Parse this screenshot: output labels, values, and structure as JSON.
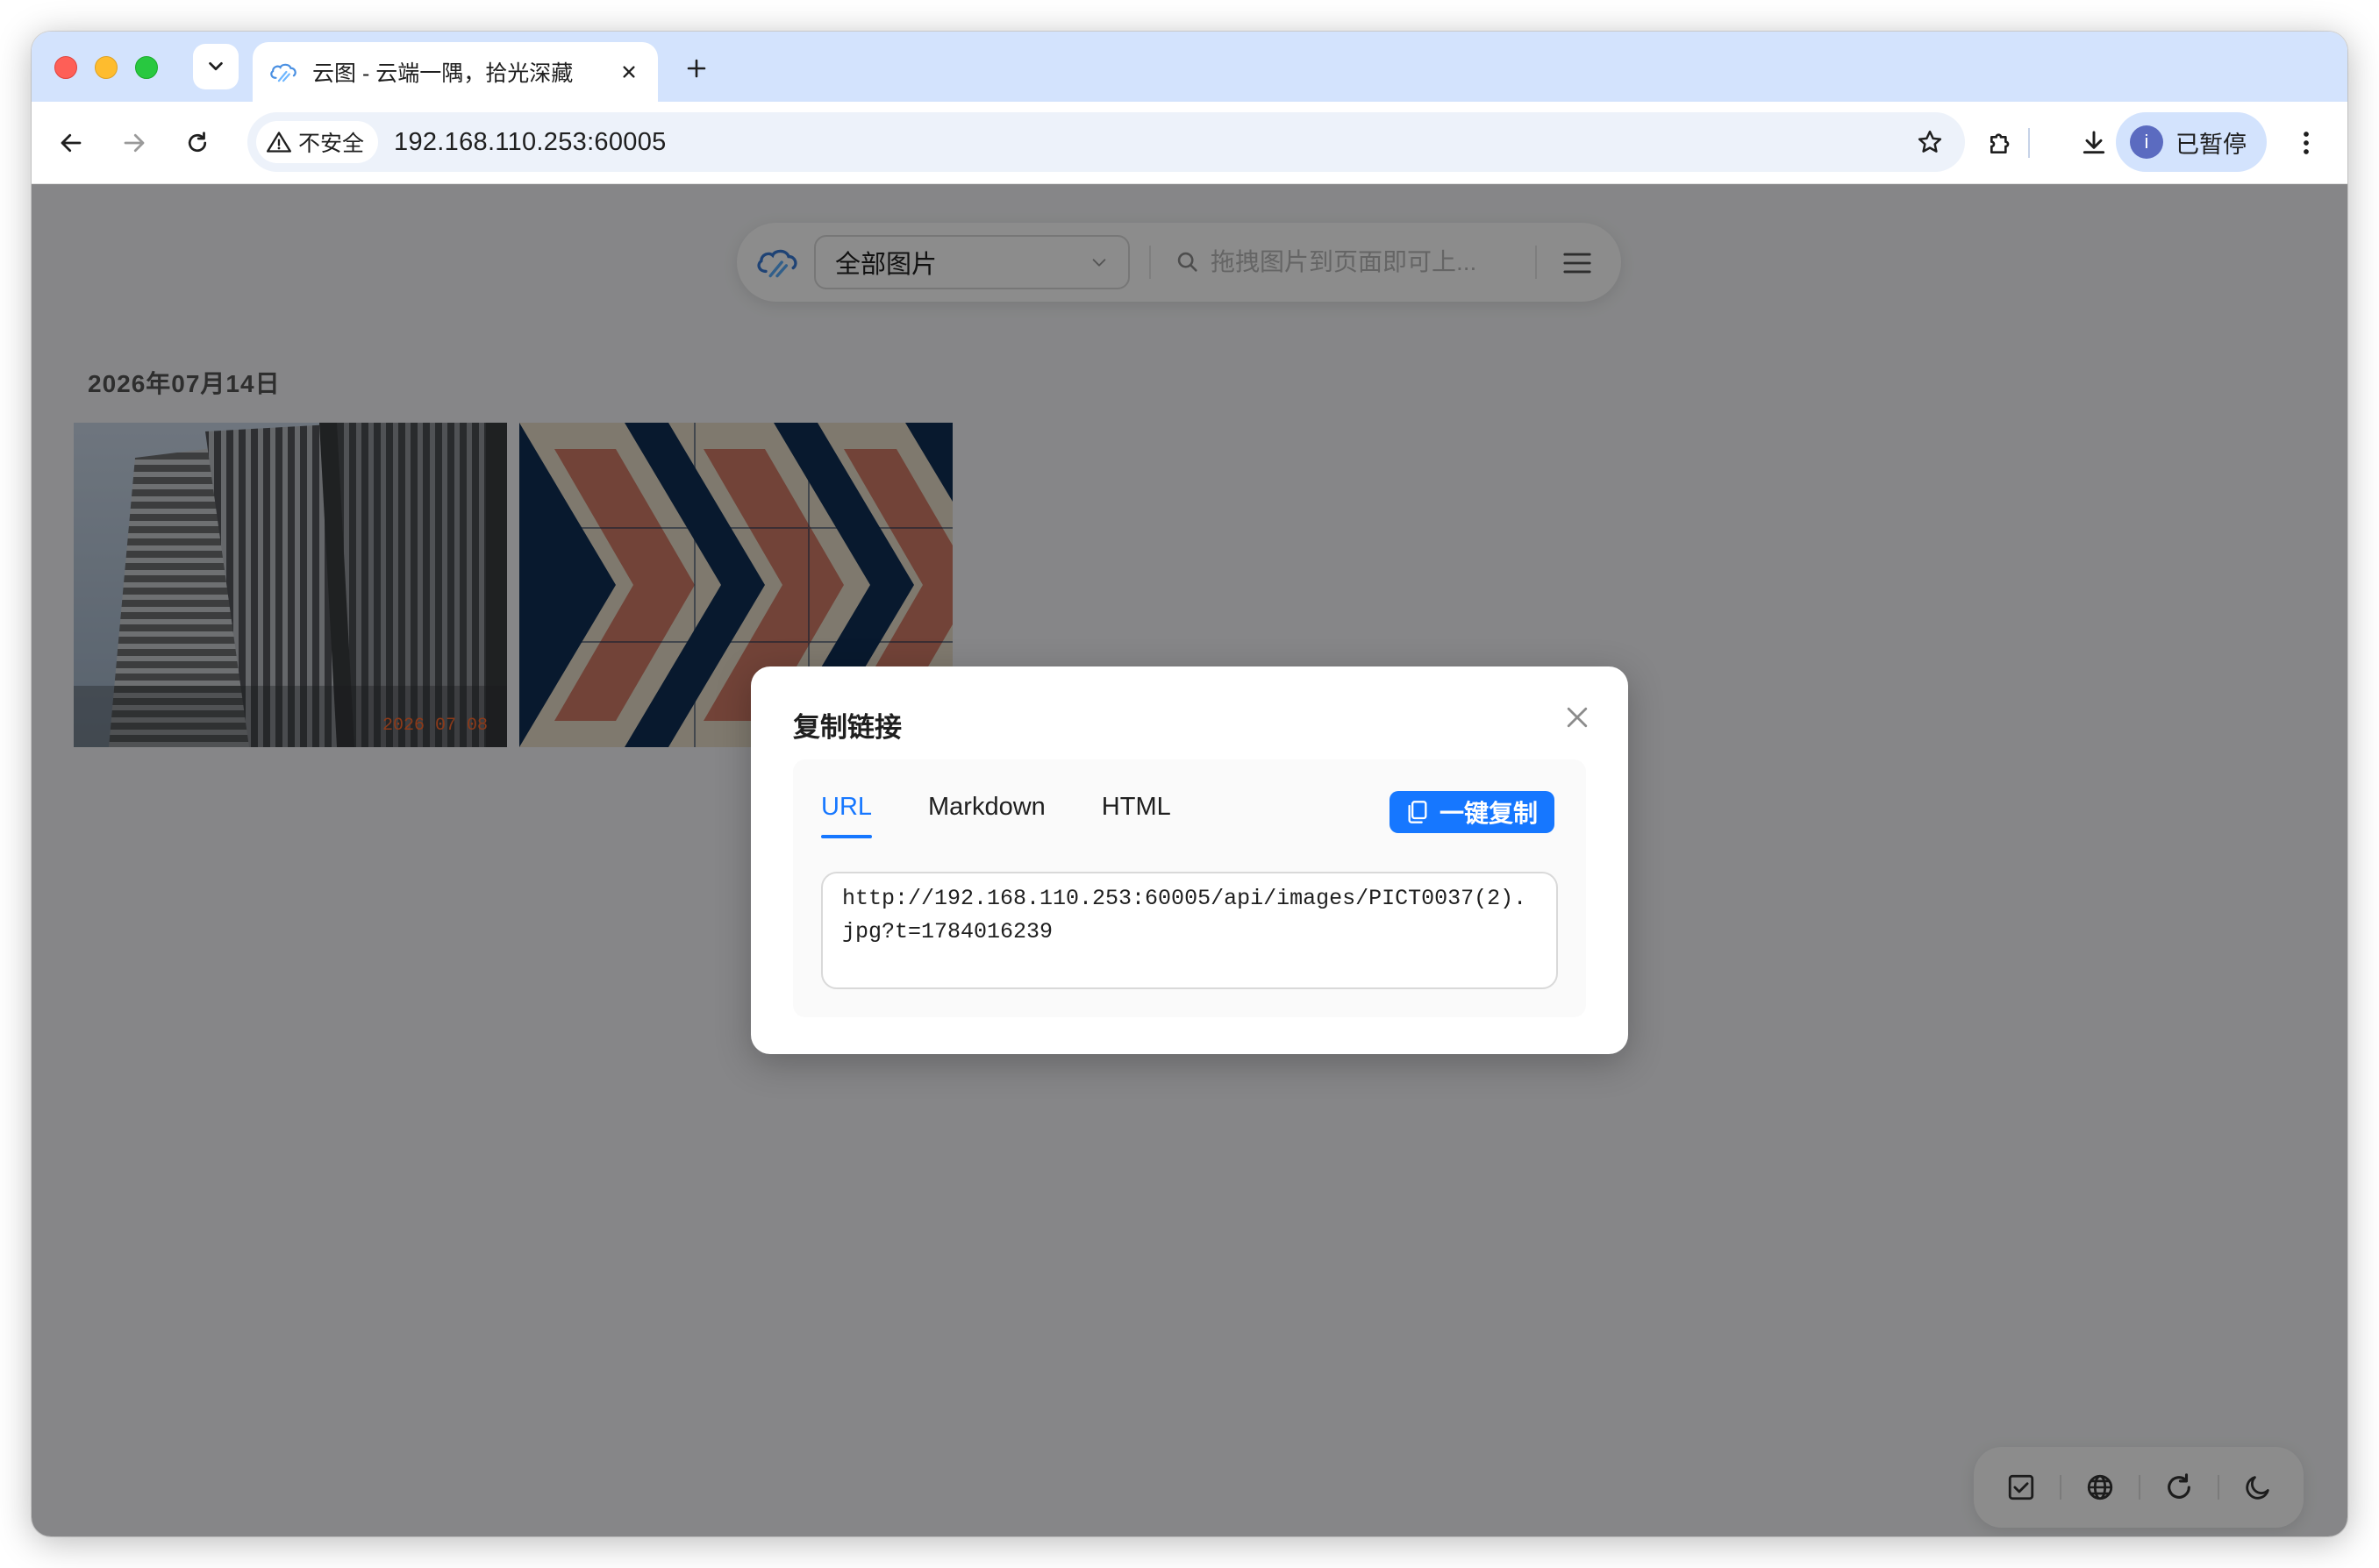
{
  "browser": {
    "tab_title": "云图 - 云端一隅，拾光深藏",
    "security_label": "不安全",
    "url": "192.168.110.253:60005",
    "profile_label": "已暂停",
    "profile_initial": "i"
  },
  "app": {
    "album_select": "全部图片",
    "search_placeholder": "拖拽图片到页面即可上..."
  },
  "gallery": {
    "date_heading": "2026年07月14日",
    "photo_timestamp": "2026 07 08"
  },
  "dialog": {
    "title": "复制链接",
    "tabs": [
      "URL",
      "Markdown",
      "HTML"
    ],
    "active_tab": "URL",
    "copy_button": "一键复制",
    "link_value": "http://192.168.110.253:60005/api/images/PICT0037(2).jpg?t=1784016239"
  },
  "colors": {
    "accent": "#1677ff",
    "tabbar": "#d3e3fd",
    "overlay": "rgba(0,0,0,0.45)"
  },
  "icons": {
    "bottom_tools": [
      "checkbox-icon",
      "globe-icon",
      "refresh-icon",
      "moon-icon"
    ]
  }
}
